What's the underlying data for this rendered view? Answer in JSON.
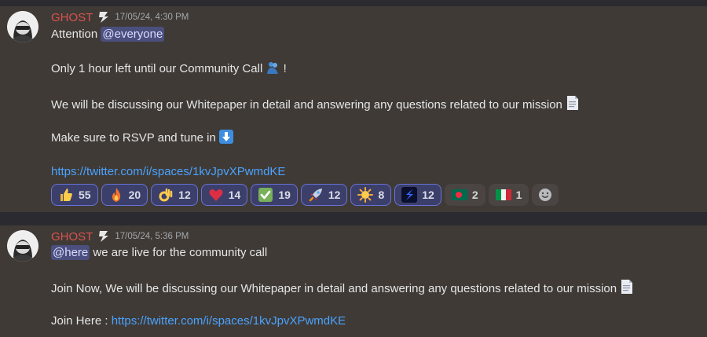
{
  "messages": [
    {
      "author": "GHOST",
      "timestamp": "17/05/24, 4:30 PM",
      "lines": {
        "l1_text": "Attention ",
        "l1_mention": "@everyone",
        "l2_text": "Only 1 hour left until our Community Call ",
        "l2_suffix": " !",
        "l3_text": "We will be discussing our Whitepaper in detail and answering any questions related to our mission ",
        "l4_text": "Make sure to RSVP and tune in ",
        "link": "https://twitter.com/i/spaces/1kvJpvXPwmdKE"
      },
      "reactions": [
        {
          "emoji": "thumbs-up",
          "count": "55"
        },
        {
          "emoji": "fire",
          "count": "20"
        },
        {
          "emoji": "ok-hand",
          "count": "12"
        },
        {
          "emoji": "heart",
          "count": "14"
        },
        {
          "emoji": "check-mark",
          "count": "19"
        },
        {
          "emoji": "rocket",
          "count": "12"
        },
        {
          "emoji": "sun",
          "count": "8"
        },
        {
          "emoji": "custom-logo",
          "count": "12"
        },
        {
          "emoji": "flag-bangladesh",
          "count": "2"
        },
        {
          "emoji": "flag-italy",
          "count": "1"
        }
      ]
    },
    {
      "author": "GHOST",
      "timestamp": "17/05/24, 5:36 PM",
      "lines": {
        "l1_mention": "@here",
        "l1_text": " we are live for the community call",
        "l2_text": "Join Now, We will be discussing our Whitepaper in detail and answering any questions related to our mission ",
        "l3_text": "Join Here : ",
        "link": "https://twitter.com/i/spaces/1kvJpvXPwmdKE"
      }
    }
  ]
}
